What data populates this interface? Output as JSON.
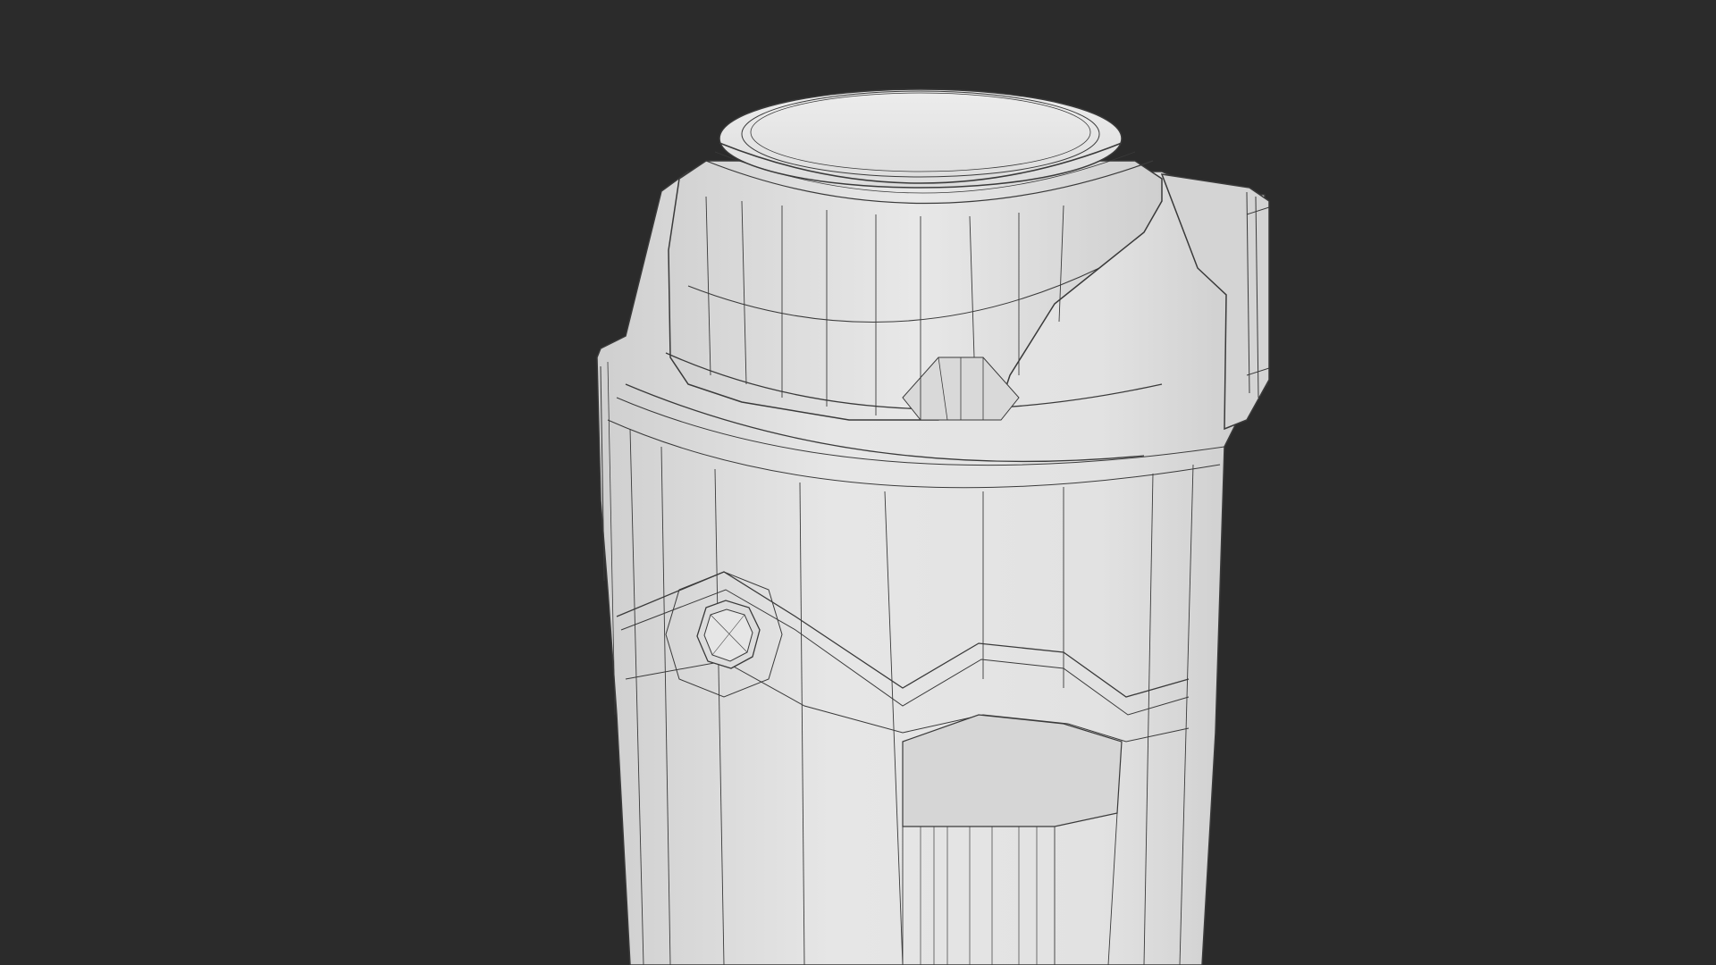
{
  "scene": {
    "background_color": "#2b2b2b",
    "surface_color": "#dedede",
    "surface_shadow_color": "#c9c9c9",
    "surface_highlight_color": "#ececec",
    "wire_color": "#3a3a3a",
    "object_icon": "wireframe-canister-model"
  }
}
